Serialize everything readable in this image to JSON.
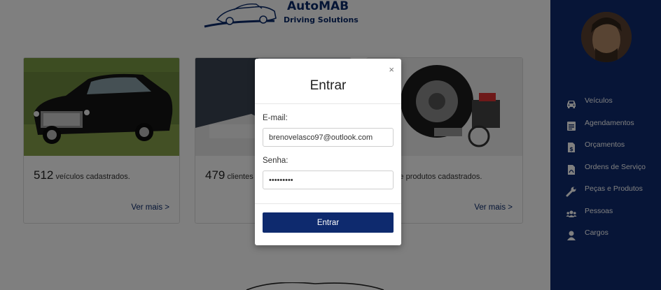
{
  "brand": {
    "name": "AutoMAB",
    "tagline": "Driving Solutions"
  },
  "cards": [
    {
      "count": "512",
      "text": "veículos cadastrados.",
      "link": "Ver mais >"
    },
    {
      "count": "479",
      "text": "clientes",
      "link": ""
    },
    {
      "count": "",
      "text": "peças e produtos cadastrados.",
      "link": "Ver mais >"
    }
  ],
  "sidebar": {
    "items": [
      {
        "label": "Veículos",
        "icon": "car-icon"
      },
      {
        "label": "Agendamentos",
        "icon": "calendar-icon"
      },
      {
        "label": "Orçamentos",
        "icon": "invoice-dollar-icon"
      },
      {
        "label": "Ordens de Serviço",
        "icon": "document-pdf-icon"
      },
      {
        "label": "Peças e Produtos",
        "icon": "wrench-icon"
      },
      {
        "label": "Pessoas",
        "icon": "users-icon"
      },
      {
        "label": "Cargos",
        "icon": "user-icon"
      }
    ]
  },
  "modal": {
    "title": "Entrar",
    "close": "×",
    "email_label": "E-mail:",
    "email_value": "brenovelasco97@outlook.com",
    "password_label": "Senha:",
    "password_value": "•••••••••",
    "submit_label": "Entrar"
  },
  "colors": {
    "primary": "#0e2a6e",
    "overlay": "rgba(0,0,0,0.5)"
  }
}
